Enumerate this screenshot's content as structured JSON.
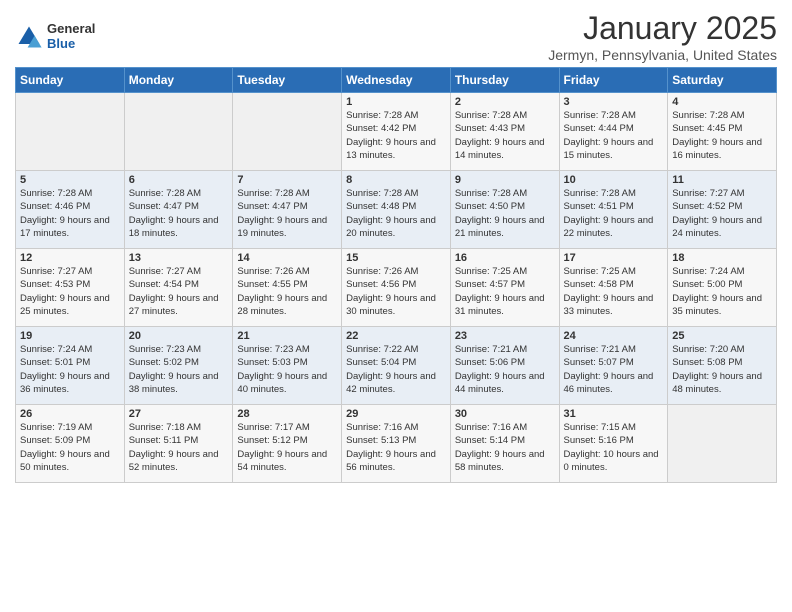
{
  "logo": {
    "general": "General",
    "blue": "Blue"
  },
  "title": "January 2025",
  "location": "Jermyn, Pennsylvania, United States",
  "days_header": [
    "Sunday",
    "Monday",
    "Tuesday",
    "Wednesday",
    "Thursday",
    "Friday",
    "Saturday"
  ],
  "weeks": [
    [
      {
        "day": "",
        "info": ""
      },
      {
        "day": "",
        "info": ""
      },
      {
        "day": "",
        "info": ""
      },
      {
        "day": "1",
        "info": "Sunrise: 7:28 AM\nSunset: 4:42 PM\nDaylight: 9 hours\nand 13 minutes."
      },
      {
        "day": "2",
        "info": "Sunrise: 7:28 AM\nSunset: 4:43 PM\nDaylight: 9 hours\nand 14 minutes."
      },
      {
        "day": "3",
        "info": "Sunrise: 7:28 AM\nSunset: 4:44 PM\nDaylight: 9 hours\nand 15 minutes."
      },
      {
        "day": "4",
        "info": "Sunrise: 7:28 AM\nSunset: 4:45 PM\nDaylight: 9 hours\nand 16 minutes."
      }
    ],
    [
      {
        "day": "5",
        "info": "Sunrise: 7:28 AM\nSunset: 4:46 PM\nDaylight: 9 hours\nand 17 minutes."
      },
      {
        "day": "6",
        "info": "Sunrise: 7:28 AM\nSunset: 4:47 PM\nDaylight: 9 hours\nand 18 minutes."
      },
      {
        "day": "7",
        "info": "Sunrise: 7:28 AM\nSunset: 4:47 PM\nDaylight: 9 hours\nand 19 minutes."
      },
      {
        "day": "8",
        "info": "Sunrise: 7:28 AM\nSunset: 4:48 PM\nDaylight: 9 hours\nand 20 minutes."
      },
      {
        "day": "9",
        "info": "Sunrise: 7:28 AM\nSunset: 4:50 PM\nDaylight: 9 hours\nand 21 minutes."
      },
      {
        "day": "10",
        "info": "Sunrise: 7:28 AM\nSunset: 4:51 PM\nDaylight: 9 hours\nand 22 minutes."
      },
      {
        "day": "11",
        "info": "Sunrise: 7:27 AM\nSunset: 4:52 PM\nDaylight: 9 hours\nand 24 minutes."
      }
    ],
    [
      {
        "day": "12",
        "info": "Sunrise: 7:27 AM\nSunset: 4:53 PM\nDaylight: 9 hours\nand 25 minutes."
      },
      {
        "day": "13",
        "info": "Sunrise: 7:27 AM\nSunset: 4:54 PM\nDaylight: 9 hours\nand 27 minutes."
      },
      {
        "day": "14",
        "info": "Sunrise: 7:26 AM\nSunset: 4:55 PM\nDaylight: 9 hours\nand 28 minutes."
      },
      {
        "day": "15",
        "info": "Sunrise: 7:26 AM\nSunset: 4:56 PM\nDaylight: 9 hours\nand 30 minutes."
      },
      {
        "day": "16",
        "info": "Sunrise: 7:25 AM\nSunset: 4:57 PM\nDaylight: 9 hours\nand 31 minutes."
      },
      {
        "day": "17",
        "info": "Sunrise: 7:25 AM\nSunset: 4:58 PM\nDaylight: 9 hours\nand 33 minutes."
      },
      {
        "day": "18",
        "info": "Sunrise: 7:24 AM\nSunset: 5:00 PM\nDaylight: 9 hours\nand 35 minutes."
      }
    ],
    [
      {
        "day": "19",
        "info": "Sunrise: 7:24 AM\nSunset: 5:01 PM\nDaylight: 9 hours\nand 36 minutes."
      },
      {
        "day": "20",
        "info": "Sunrise: 7:23 AM\nSunset: 5:02 PM\nDaylight: 9 hours\nand 38 minutes."
      },
      {
        "day": "21",
        "info": "Sunrise: 7:23 AM\nSunset: 5:03 PM\nDaylight: 9 hours\nand 40 minutes."
      },
      {
        "day": "22",
        "info": "Sunrise: 7:22 AM\nSunset: 5:04 PM\nDaylight: 9 hours\nand 42 minutes."
      },
      {
        "day": "23",
        "info": "Sunrise: 7:21 AM\nSunset: 5:06 PM\nDaylight: 9 hours\nand 44 minutes."
      },
      {
        "day": "24",
        "info": "Sunrise: 7:21 AM\nSunset: 5:07 PM\nDaylight: 9 hours\nand 46 minutes."
      },
      {
        "day": "25",
        "info": "Sunrise: 7:20 AM\nSunset: 5:08 PM\nDaylight: 9 hours\nand 48 minutes."
      }
    ],
    [
      {
        "day": "26",
        "info": "Sunrise: 7:19 AM\nSunset: 5:09 PM\nDaylight: 9 hours\nand 50 minutes."
      },
      {
        "day": "27",
        "info": "Sunrise: 7:18 AM\nSunset: 5:11 PM\nDaylight: 9 hours\nand 52 minutes."
      },
      {
        "day": "28",
        "info": "Sunrise: 7:17 AM\nSunset: 5:12 PM\nDaylight: 9 hours\nand 54 minutes."
      },
      {
        "day": "29",
        "info": "Sunrise: 7:16 AM\nSunset: 5:13 PM\nDaylight: 9 hours\nand 56 minutes."
      },
      {
        "day": "30",
        "info": "Sunrise: 7:16 AM\nSunset: 5:14 PM\nDaylight: 9 hours\nand 58 minutes."
      },
      {
        "day": "31",
        "info": "Sunrise: 7:15 AM\nSunset: 5:16 PM\nDaylight: 10 hours\nand 0 minutes."
      },
      {
        "day": "",
        "info": ""
      }
    ]
  ]
}
